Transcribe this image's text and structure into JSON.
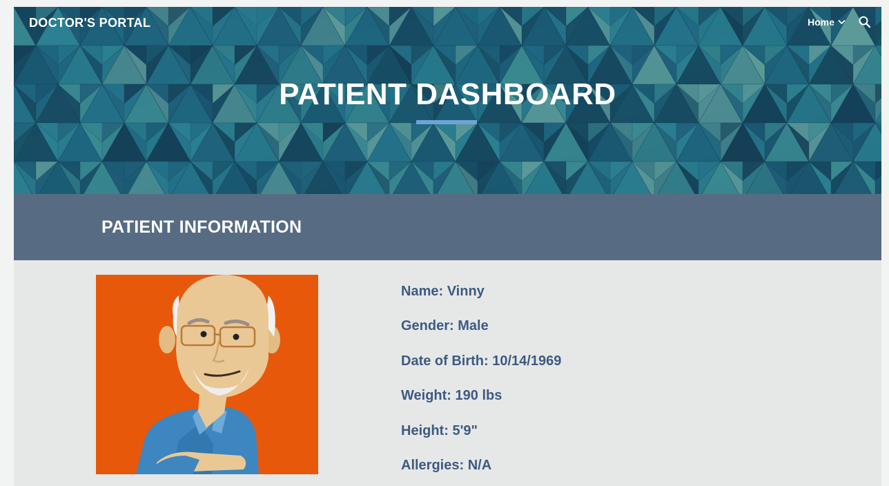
{
  "header": {
    "site_title": "DOCTOR'S PORTAL",
    "nav_home": "Home",
    "search_icon": "search-icon"
  },
  "hero": {
    "title": "PATIENT DASHBOARD"
  },
  "section": {
    "title": "PATIENT INFORMATION"
  },
  "patient": {
    "photo_icon": "patient-avatar-illustration",
    "fields": [
      {
        "label": "Name:",
        "value": "Vinny"
      },
      {
        "label": "Gender:",
        "value": "Male"
      },
      {
        "label": "Date of Birth:",
        "value": "10/14/1969"
      },
      {
        "label": "Weight:",
        "value": "190 lbs"
      },
      {
        "label": "Height:",
        "value": "5'9\""
      },
      {
        "label": "Allergies:",
        "value": "N/A"
      }
    ]
  },
  "colors": {
    "banner": "#1c5a72",
    "section_bar": "#576c82",
    "accent": "#6fa3d6",
    "info_text": "#3d5a80",
    "photo_bg": "#e8580b",
    "content_bg": "#e6e8e8"
  }
}
